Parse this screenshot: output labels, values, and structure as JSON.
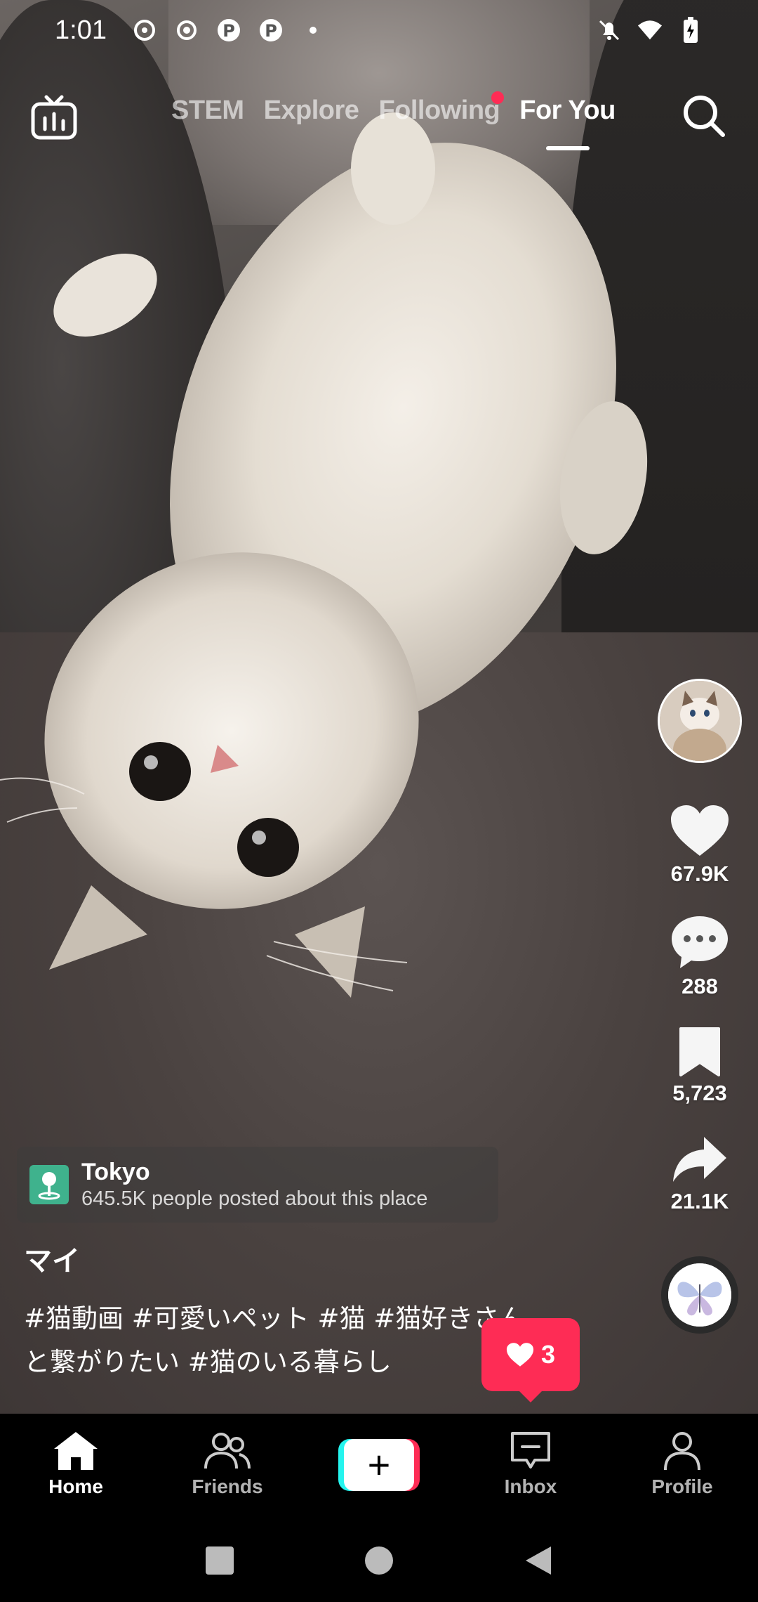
{
  "status_bar": {
    "time": "1:01",
    "left_icons": [
      "threads-icon",
      "record-icon",
      "pinterest-icon",
      "pinterest-icon",
      "dot-icon"
    ],
    "right_icons": [
      "mute-bell-icon",
      "wifi-icon",
      "battery-charging-icon"
    ]
  },
  "top_nav": {
    "tabs": [
      {
        "label": "STEM",
        "active": false
      },
      {
        "label": "Explore",
        "active": false
      },
      {
        "label": "Following",
        "active": false,
        "badge_dot": true
      },
      {
        "label": "For You",
        "active": true
      }
    ]
  },
  "rail": {
    "likes": "67.9K",
    "comments": "288",
    "saves": "5,723",
    "shares": "21.1K"
  },
  "location": {
    "name": "Tokyo",
    "subtitle": "645.5K people posted about this place"
  },
  "post": {
    "author": "マイ",
    "caption_line1": "#猫動画 #可愛いペット #猫 #猫好きさん",
    "caption_line2": "と繋がりたい #猫のいる暮らし"
  },
  "like_bubble": {
    "count": "3"
  },
  "bottom_nav": {
    "home": "Home",
    "friends": "Friends",
    "inbox": "Inbox",
    "profile": "Profile",
    "create": "+"
  },
  "colors": {
    "accent": "#fe2c55",
    "cyan": "#25f4ee",
    "location_icon": "#3fb28d"
  }
}
